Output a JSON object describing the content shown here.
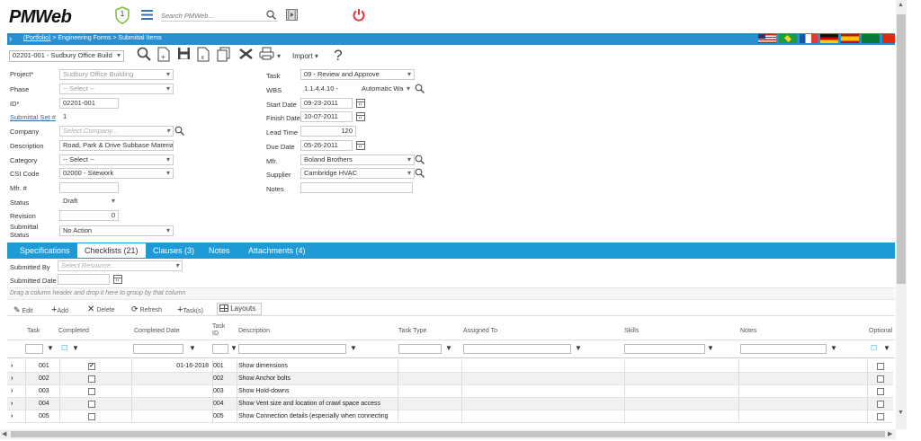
{
  "app": {
    "logo": "PMWeb",
    "notif_count": "1",
    "search_placeholder": "Search PMWeb..."
  },
  "breadcrumb": {
    "portfolio": "(Portfolio)",
    "rest": " > Engineering Forms > Submittal Items"
  },
  "toolbar": {
    "record_select": "02201-001 - Sudbury Office Build",
    "import_label": "Import",
    "help": "?"
  },
  "form": {
    "project_label": "Project*",
    "project_value": "Sudbury Office Building",
    "phase_label": "Phase",
    "phase_value": "-- Select --",
    "id_label": "ID*",
    "id_value": "02201-001",
    "subset_label": "Submittal Set #",
    "subset_value": "1",
    "company_label": "Company",
    "company_placeholder": "Select Company...",
    "description_label": "Description",
    "description_value": "Road, Park & Drive Subbase Materials",
    "category_label": "Category",
    "category_value": "-- Select --",
    "csi_label": "CSI Code",
    "csi_value": "02000 - Sitework",
    "mfr_no_label": "Mfr. #",
    "mfr_no_value": "",
    "status_label": "Status",
    "status_value": "Draft",
    "revision_label": "Revision",
    "revision_value": "0",
    "submittal_status_label_1": "Submittal",
    "submittal_status_label_2": "Status",
    "submittal_status_value": "No Action",
    "task_label": "Task",
    "task_value": "09 - Review and Approve",
    "wbs_label": "WBS",
    "wbs_value": "1.1.4.4.10 -",
    "wbs_mode": "Automatic Wa",
    "start_label": "Start Date",
    "start_value": "09-23-2011",
    "finish_label": "Finish Date",
    "finish_value": "10-07-2011",
    "lead_label": "Lead Time",
    "lead_value": "120",
    "due_label": "Due Date",
    "due_value": "05-26-2011",
    "mfr_label": "Mfr.",
    "mfr_value": "Boland Brothers",
    "supplier_label": "Supplier",
    "supplier_value": "Cambridge HVAC",
    "notes_label": "Notes",
    "notes_value": ""
  },
  "tabs": [
    {
      "label": "Specifications"
    },
    {
      "label": "Checklists (21)"
    },
    {
      "label": "Clauses (3)"
    },
    {
      "label": "Notes"
    },
    {
      "label": "Attachments (4)"
    }
  ],
  "checklist": {
    "submitted_by_label": "Submitted By",
    "submitted_by_placeholder": "Select Resource...",
    "submitted_date_label": "Submitted Date",
    "group_hint": "Drag a column header and drop it here to group by that column",
    "actions": {
      "edit": "Edit",
      "add": "Add",
      "delete": "Delete",
      "refresh": "Refresh",
      "tasks": "Task(s)",
      "layouts": "Layouts"
    },
    "columns": {
      "task": "Task",
      "completed": "Completed",
      "completed_date": "Completed Date",
      "task_id_1": "Task",
      "task_id_2": "ID",
      "description": "Description",
      "task_type": "Task Type",
      "assigned_to": "Assigned To",
      "skills": "Skills",
      "notes": "Notes",
      "optional": "Optional"
    },
    "rows": [
      {
        "task": "001",
        "completed": true,
        "date": "01-16-2018",
        "id": "001",
        "desc": "Show dimensions"
      },
      {
        "task": "002",
        "completed": false,
        "date": "",
        "id": "002",
        "desc": "Show Anchor bolts"
      },
      {
        "task": "003",
        "completed": false,
        "date": "",
        "id": "003",
        "desc": "Show Hold-downs"
      },
      {
        "task": "004",
        "completed": false,
        "date": "",
        "id": "004",
        "desc": "Show Vent size and location of crawl space access"
      },
      {
        "task": "005",
        "completed": false,
        "date": "",
        "id": "005",
        "desc": "Show Connection details (especially when connecting"
      }
    ]
  },
  "colors": {
    "brand_blue": "#1e9bd7",
    "breadcrumb_bar": "#2a8fcf",
    "power_red": "#e53935",
    "logo_green": "#7cbf3c"
  }
}
